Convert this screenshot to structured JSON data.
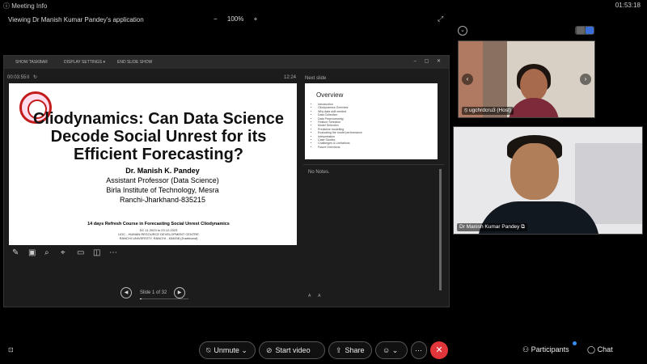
{
  "window": {
    "title": "Meeting Info",
    "time": "01:53:18"
  },
  "view": {
    "title": "Viewing Dr Manish Kumar Pandey's application",
    "zoom_out": "−",
    "zoom": "100%",
    "zoom_in": "+"
  },
  "ppt": {
    "toolbar": [
      "SHOW TASKBAR",
      "DISPLAY SETTINGS ▾",
      "END SLIDE SHOW"
    ],
    "elapsed": "00:03:55",
    "pause": "II",
    "reset": "↻",
    "clock": "12:24",
    "slide": {
      "title": "Cliodynamics: Can Data Science Decode Social Unrest for its Efficient Forecasting?",
      "author": [
        "Dr. Manish K. Pandey",
        "Assistant Professor (Data Science)",
        "Birla Institute of Technology, Mesra",
        "Ranchi-Jharkhand-835215"
      ],
      "course": "14 days Refresh Course in Forecasting Social Unrest Cliodynamics",
      "small": [
        "DC 11.2023 to 23.12.2023",
        "UGC - HUMAN RESOURCE DEVELOPMENT CENTRE",
        "RANCHI UNIVERSITY, RANCHI - 834008 (Jharkhand)"
      ]
    },
    "slide_counter": "Slide 1 of 32",
    "progress": 0.03,
    "next_label": "Next slide",
    "next": {
      "title": "Overview",
      "items": [
        "Introduction",
        "Cliodynamics Overview",
        "Why data skill needed",
        "Data Collection",
        "Data Preprocessing",
        "Feature Selection",
        "Model Selection",
        "Predictive modelling",
        "Evaluating the model performance",
        "Interpretation",
        "Case Studies",
        "Challenges & Limitations",
        "Future Directions"
      ]
    },
    "notes": "No Notes.",
    "font_controls": "A  A"
  },
  "participants": [
    {
      "name": "ugchrdcru3 (Host)"
    },
    {
      "name": "Dr Manish Kumar Pandey"
    }
  ],
  "bottom": {
    "unmute": "Unmute",
    "start_video": "Start video",
    "share": "Share",
    "participants": "Participants",
    "chat": "Chat"
  },
  "colors": {
    "end_call": "#e0353a",
    "badge": "#3a8ef6"
  }
}
